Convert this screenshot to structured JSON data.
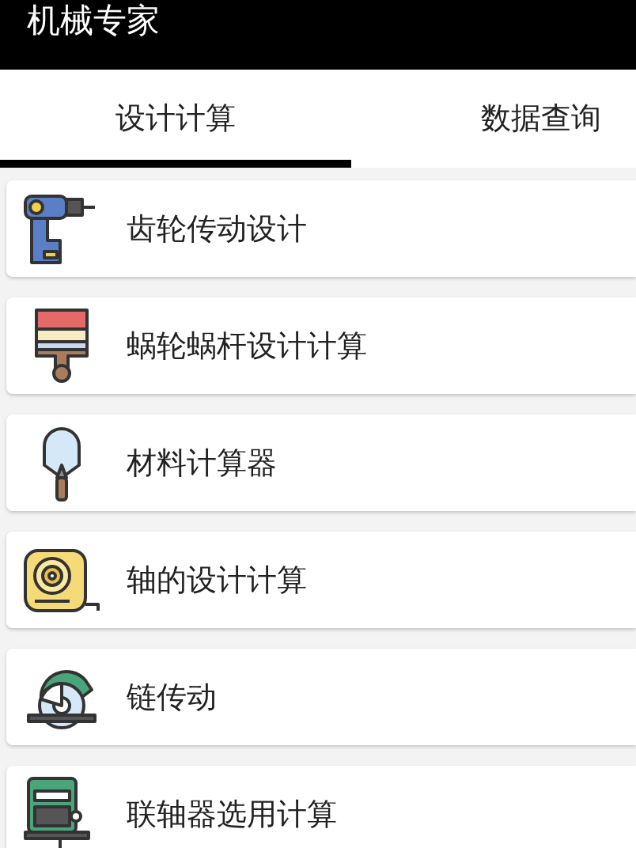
{
  "app_bar": {
    "title": "机械专家"
  },
  "tabs": [
    {
      "label": "设计计算",
      "selected": true
    },
    {
      "label": "数据查询",
      "selected": false
    }
  ],
  "items": [
    {
      "label": "齿轮传动设计"
    },
    {
      "label": "蜗轮蜗杆设计计算"
    },
    {
      "label": "材料计算器"
    },
    {
      "label": "轴的设计计算"
    },
    {
      "label": "链传动"
    },
    {
      "label": "联轴器选用计算"
    }
  ]
}
